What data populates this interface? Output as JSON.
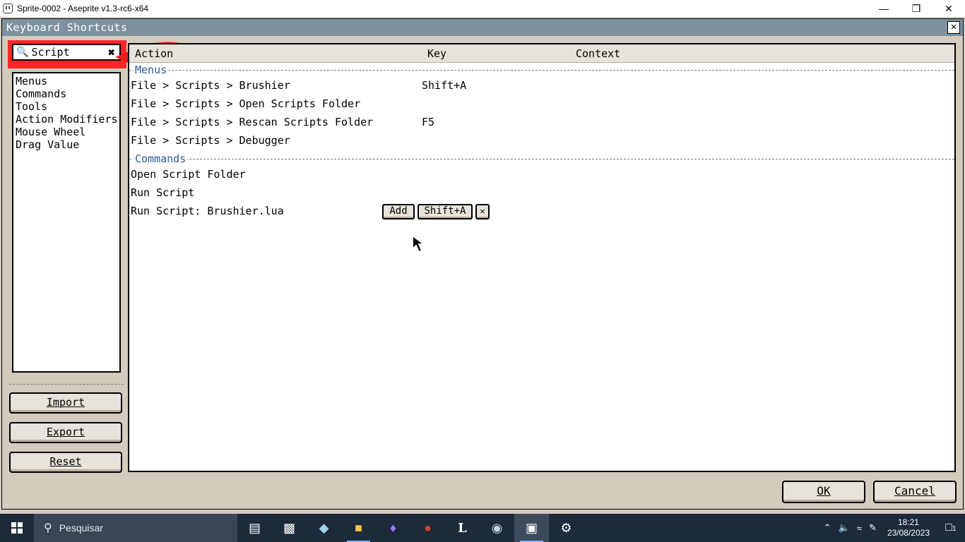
{
  "os_window": {
    "title": "Sprite-0002 - Aseprite v1.3-rc6-x64",
    "minimize": "—",
    "restore": "❐",
    "close": "✕"
  },
  "dialog": {
    "title": "Keyboard Shortcuts",
    "close_glyph": "✕",
    "search": {
      "value": "Script",
      "clear_glyph": "✖"
    },
    "categories": [
      "Menus",
      "Commands",
      "Tools",
      "Action Modifiers",
      "Mouse Wheel",
      "Drag Value"
    ],
    "side_buttons": {
      "import": "Import",
      "export": "Export",
      "reset": "Reset"
    },
    "table": {
      "columns": {
        "action": "Action",
        "key": "Key",
        "context": "Context"
      },
      "sections": [
        {
          "name": "Menus",
          "rows": [
            {
              "action": "File > Scripts > Brushier",
              "key": "Shift+A"
            },
            {
              "action": "File > Scripts > Open Scripts Folder",
              "key": ""
            },
            {
              "action": "File > Scripts > Rescan Scripts Folder",
              "key": "F5"
            },
            {
              "action": "File > Scripts > Debugger",
              "key": ""
            }
          ]
        },
        {
          "name": "Commands",
          "rows": [
            {
              "action": "Open Script Folder",
              "key": ""
            },
            {
              "action": "Run Script",
              "key": ""
            },
            {
              "action": "Run Script: Brushier.lua",
              "key": ""
            }
          ]
        }
      ],
      "row_editor": {
        "add": "Add",
        "shortcut": "Shift+A",
        "remove": "✕"
      }
    },
    "footer": {
      "ok": "OK",
      "cancel": "Cancel"
    }
  },
  "taskbar": {
    "search_placeholder": "Pesquisar",
    "time": "18:21",
    "date": "23/08/2023",
    "notifications": "1",
    "icons": [
      "windows-start-icon",
      "task-view-icon",
      "terminal-icon",
      "cube-icon",
      "file-explorer-icon",
      "crystal-icon",
      "game-character-icon",
      "l-app-icon",
      "steam-icon",
      "aseprite-icon",
      "settings-icon"
    ]
  },
  "colors": {
    "dialog_title_bg": "#7d929e",
    "highlight": "#ff2626",
    "section_label": "#2d5a99",
    "panel_bg": "#d3cbbe"
  }
}
